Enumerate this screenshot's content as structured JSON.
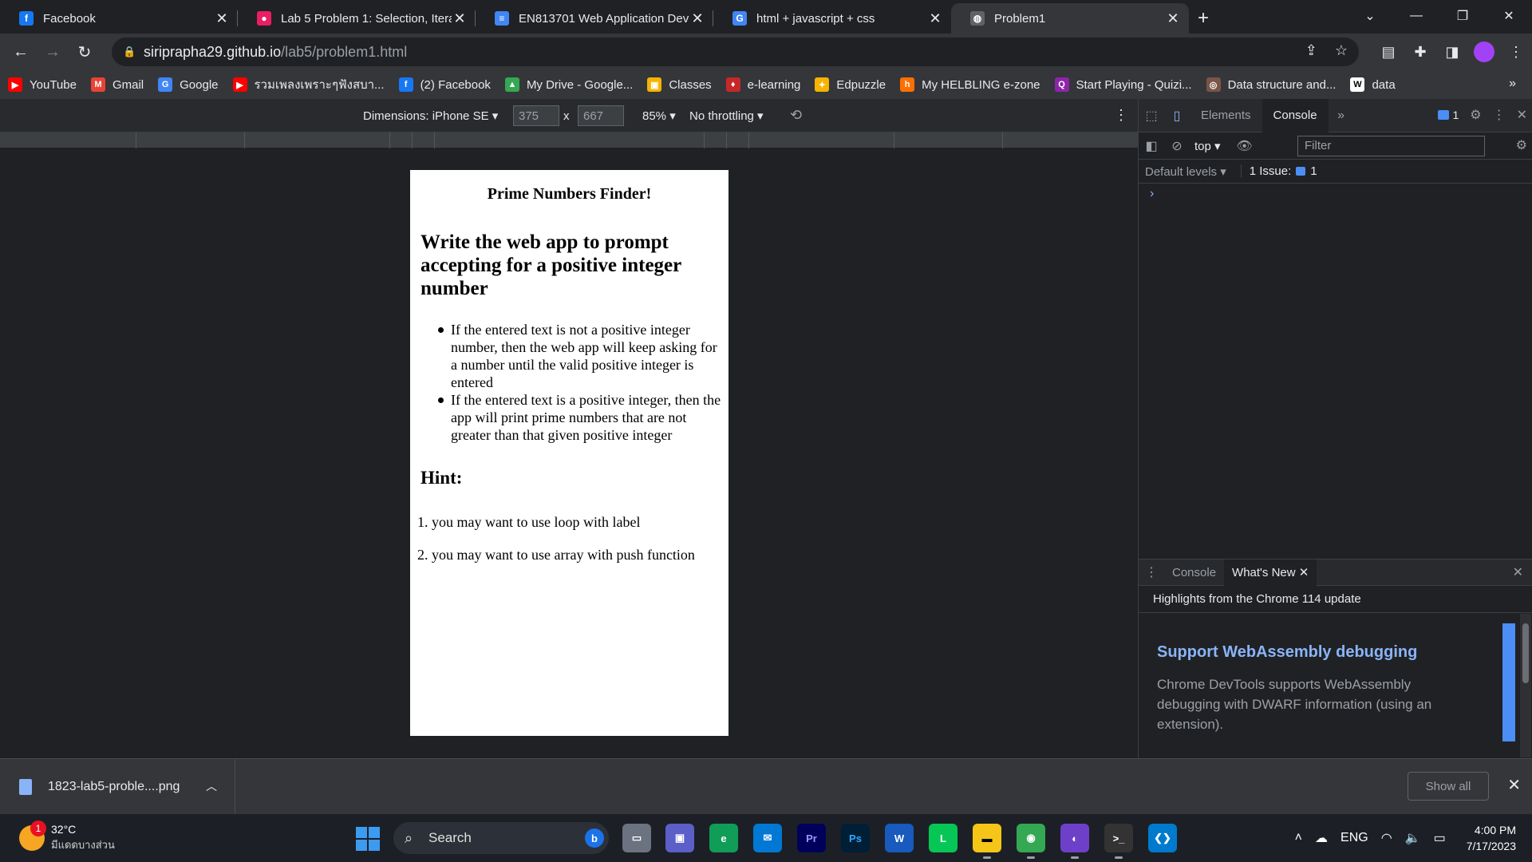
{
  "tabs": [
    {
      "title": "Facebook",
      "favicon_color": "#1877f2",
      "favicon_glyph": "f",
      "active": false
    },
    {
      "title": "Lab 5 Problem 1: Selection, Iterat",
      "favicon_color": "#e91e63",
      "favicon_glyph": "●",
      "active": false
    },
    {
      "title": "EN813701 Web Application Deve",
      "favicon_color": "#4285f4",
      "favicon_glyph": "≡",
      "active": false
    },
    {
      "title": "html + javascript + css",
      "favicon_color": "#4285f4",
      "favicon_glyph": "G",
      "active": false
    },
    {
      "title": "Problem1",
      "favicon_color": "#9aa0a6",
      "favicon_glyph": "◍",
      "active": true
    }
  ],
  "address": {
    "host": "siriprapha29.github.io",
    "path": "/lab5/problem1.html"
  },
  "bookmarks": [
    {
      "label": "YouTube",
      "icon": "youtube-icon",
      "color": "#ff0000",
      "glyph": "▶"
    },
    {
      "label": "Gmail",
      "icon": "gmail-icon",
      "color": "#ea4335",
      "glyph": "M"
    },
    {
      "label": "Google",
      "icon": "google-icon",
      "color": "#4285f4",
      "glyph": "G"
    },
    {
      "label": "รวมเพลงเพราะๆฟังสบา...",
      "icon": "youtube-icon",
      "color": "#ff0000",
      "glyph": "▶"
    },
    {
      "label": "(2) Facebook",
      "icon": "facebook-icon",
      "color": "#1877f2",
      "glyph": "f"
    },
    {
      "label": "My Drive - Google...",
      "icon": "drive-icon",
      "color": "#34a853",
      "glyph": "▲"
    },
    {
      "label": "Classes",
      "icon": "classroom-icon",
      "color": "#f4b400",
      "glyph": "▣"
    },
    {
      "label": "e-learning",
      "icon": "elearning-icon",
      "color": "#c62828",
      "glyph": "♦"
    },
    {
      "label": "Edpuzzle",
      "icon": "edpuzzle-icon",
      "color": "#f4b400",
      "glyph": "✦"
    },
    {
      "label": "My HELBLING e-zone",
      "icon": "helbling-icon",
      "color": "#ff6f00",
      "glyph": "h"
    },
    {
      "label": "Start Playing - Quizi...",
      "icon": "quizizz-icon",
      "color": "#8e24aa",
      "glyph": "Q"
    },
    {
      "label": "Data structure and...",
      "icon": "datastructure-icon",
      "color": "#795548",
      "glyph": "◎"
    },
    {
      "label": "data",
      "icon": "wiki-icon",
      "color": "#ffffff",
      "glyph": "W"
    }
  ],
  "device_toolbar": {
    "dimensions_label": "Dimensions: iPhone SE",
    "width": "375",
    "height": "667",
    "times": "x",
    "zoom": "85%",
    "throttling": "No throttling"
  },
  "page": {
    "small_title": "Prime Numbers Finder!",
    "heading": "Write the web app to prompt accepting for a positive integer number",
    "bullets": [
      "If the entered text is not a positive integer number, then the web app will keep asking for a number until the valid positive integer is entered",
      "If the entered text is a positive integer, then the app will print prime numbers that are not greater than that given positive integer"
    ],
    "hint_heading": "Hint:",
    "hints": [
      "1. you may want to use loop with label",
      "2. you may want to use array with push function"
    ]
  },
  "devtools": {
    "tabs": [
      "Elements",
      "Console"
    ],
    "active_tab": "Console",
    "issues_count": "1",
    "context": "top",
    "filter_placeholder": "Filter",
    "default_levels": "Default levels",
    "issues_label": "1 Issue:",
    "issues_num": "1",
    "drawer_tabs": [
      "Console",
      "What's New"
    ],
    "highlights": "Highlights from the Chrome 114 update",
    "wn_title": "Support WebAssembly debugging",
    "wn_body": "Chrome DevTools supports WebAssembly debugging with DWARF information (using an extension)."
  },
  "download": {
    "filename": "1823-lab5-proble....png",
    "show_all": "Show all"
  },
  "taskbar": {
    "temperature": "32°C",
    "weather_desc": "มีแดดบางส่วน",
    "notification_count": "1",
    "search_label": "Search",
    "language": "ENG",
    "time": "4:00 PM",
    "date": "7/17/2023"
  }
}
